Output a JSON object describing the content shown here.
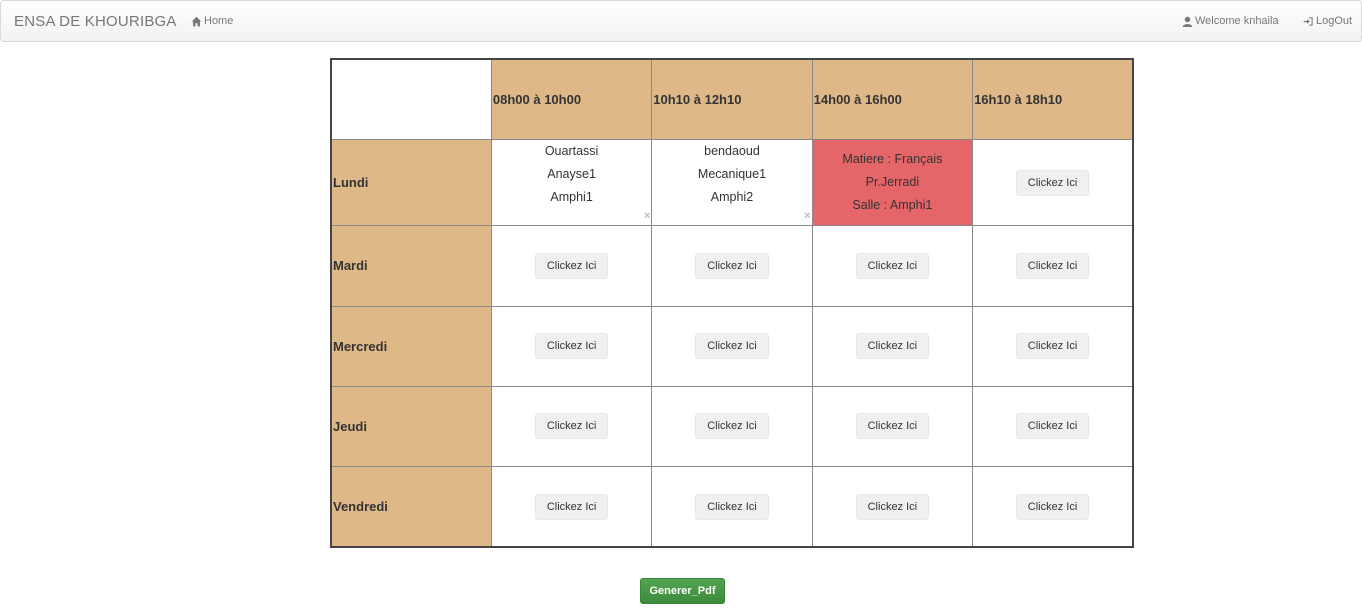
{
  "navbar": {
    "brand": "ENSA DE KHOURIBGA",
    "home_label": "Home",
    "welcome_label": "Welcome knhaila",
    "logout_label": "LogOut"
  },
  "timetable": {
    "time_slots": [
      "08h00 à 10h00",
      "10h10 à 12h10",
      "14h00 à 16h00",
      "16h10 à 18h10"
    ],
    "days": [
      "Lundi",
      "Mardi",
      "Mercredi",
      "Jeudi",
      "Vendredi"
    ],
    "empty_cell_button_label": "Clickez Ici",
    "lundi": {
      "slot1": {
        "teacher": "Ouartassi",
        "subject": "Anayse1",
        "room": "Amphi1",
        "remove_icon": "×"
      },
      "slot2": {
        "teacher": "bendaoud",
        "subject": "Mecanique1",
        "room": "Amphi2",
        "remove_icon": "×"
      },
      "slot3": {
        "subject_line": "Matiere : Français",
        "teacher_line": "Pr.Jerradi",
        "room_line": "Salle : Amphi1",
        "color": "#e46669"
      }
    }
  },
  "actions": {
    "generate_pdf_label": "Generer_Pdf"
  },
  "colors": {
    "header_bg": "#deb887",
    "highlight_cell": "#e46669",
    "pdf_button": "#449d44"
  }
}
